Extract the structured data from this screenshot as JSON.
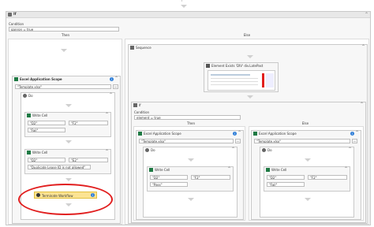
{
  "if_main": {
    "title": "If",
    "condition_label": "Condition",
    "condition_value": "ganron = true",
    "then_label": "Then",
    "else_label": "Else"
  },
  "excel_left": {
    "title": "Excel Application Scope",
    "path_value": "\"Template.xlsx\"",
    "browse": "..."
  },
  "do_left": {
    "title": "Do"
  },
  "write_left_1": {
    "title": "Write Cell",
    "cell_a": "\"D2\"",
    "cell_b": "\"F2\"",
    "value": "\"Fail\""
  },
  "write_left_2": {
    "title": "Write Cell",
    "cell_a": "\"D2\"",
    "cell_b": "\"E2\"",
    "value": "\"Duplicate Lease ID is not allowed\""
  },
  "terminate": {
    "title": "Terminate Workflow"
  },
  "sequence": {
    "title": "Sequence"
  },
  "element_exists": {
    "title": "Element Exists 'DIV' div.LatePast"
  },
  "if_inner": {
    "title": "If",
    "condition_label": "Condition",
    "condition_value": "element = true",
    "then_label": "Then",
    "else_label": "Else"
  },
  "excel_mid": {
    "title": "Excel Application Scope",
    "path_value": "\"Template.xlsx\"",
    "browse": "..."
  },
  "do_mid": {
    "title": "Do"
  },
  "write_mid": {
    "title": "Write Cell",
    "cell_a": "\"D2\"",
    "cell_b": "\"F2\"",
    "value": "\"Pass\""
  },
  "excel_right": {
    "title": "Excel Application Scope",
    "path_value": "\"Template.xlsx\"",
    "browse": "..."
  },
  "do_right": {
    "title": "Do"
  },
  "write_right": {
    "title": "Write Cell",
    "cell_a": "\"D2\"",
    "cell_b": "\"F2\"",
    "value": "\"Fail\""
  },
  "icons": {
    "collapse": "collapse-icon",
    "info": "info-icon",
    "activity": "activity-icon"
  },
  "colors": {
    "annotation": "#e11e1e",
    "terminate_bg": "#fbe393",
    "info": "#2f7ed8"
  }
}
